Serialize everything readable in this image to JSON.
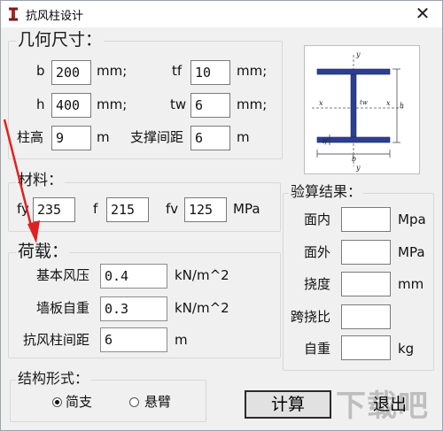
{
  "window": {
    "title": "抗风柱设计",
    "close_glyph": "✕"
  },
  "geometry_group": {
    "legend": "几何尺寸：",
    "fields": [
      {
        "label": "b",
        "value": "200",
        "unit": "mm;"
      },
      {
        "label": "tf",
        "value": "10",
        "unit": "mm;"
      },
      {
        "label": "h",
        "value": "400",
        "unit": "mm;"
      },
      {
        "label": "tw",
        "value": "6",
        "unit": "mm;"
      },
      {
        "label": "柱高",
        "value": "9",
        "unit": "m"
      },
      {
        "label": "支撑间距",
        "value": "6",
        "unit": "m"
      }
    ]
  },
  "section_diagram": {
    "labels": {
      "y_top": "y",
      "y_bottom": "y",
      "x_left": "x",
      "x_right": "x",
      "tw": "tw",
      "tf": "tf",
      "h": "h",
      "b": "b"
    }
  },
  "material_group": {
    "legend": "材料：",
    "fields": [
      {
        "label": "fy",
        "value": "235"
      },
      {
        "label": "f",
        "value": "215"
      },
      {
        "label": "fv",
        "value": "125"
      }
    ],
    "unit": "MPa"
  },
  "load_group": {
    "legend": "荷载：",
    "fields": [
      {
        "label": "基本风压",
        "value": "0.4",
        "unit": "kN/m^2"
      },
      {
        "label": "墙板自重",
        "value": "0.3",
        "unit": "kN/m^2"
      },
      {
        "label": "抗风柱间距",
        "value": "6",
        "unit": "m"
      }
    ]
  },
  "results_group": {
    "legend": "验算结果：",
    "fields": [
      {
        "label": "面内",
        "value": "",
        "unit": "Mpa"
      },
      {
        "label": "面外",
        "value": "",
        "unit": "MPa"
      },
      {
        "label": "挠度",
        "value": "",
        "unit": "mm"
      },
      {
        "label": "跨挠比",
        "value": "",
        "unit": ""
      },
      {
        "label": "自重",
        "value": "",
        "unit": "kg"
      }
    ]
  },
  "structure_group": {
    "legend": "结构形式：",
    "options": [
      {
        "label": "简支",
        "selected": true
      },
      {
        "label": "悬臂",
        "selected": false
      }
    ]
  },
  "buttons": {
    "calculate": "计算",
    "exit": "退出"
  },
  "watermark": "下载吧",
  "colors": {
    "arrow": "#e02020",
    "section_fill": "#2c3f8f"
  }
}
